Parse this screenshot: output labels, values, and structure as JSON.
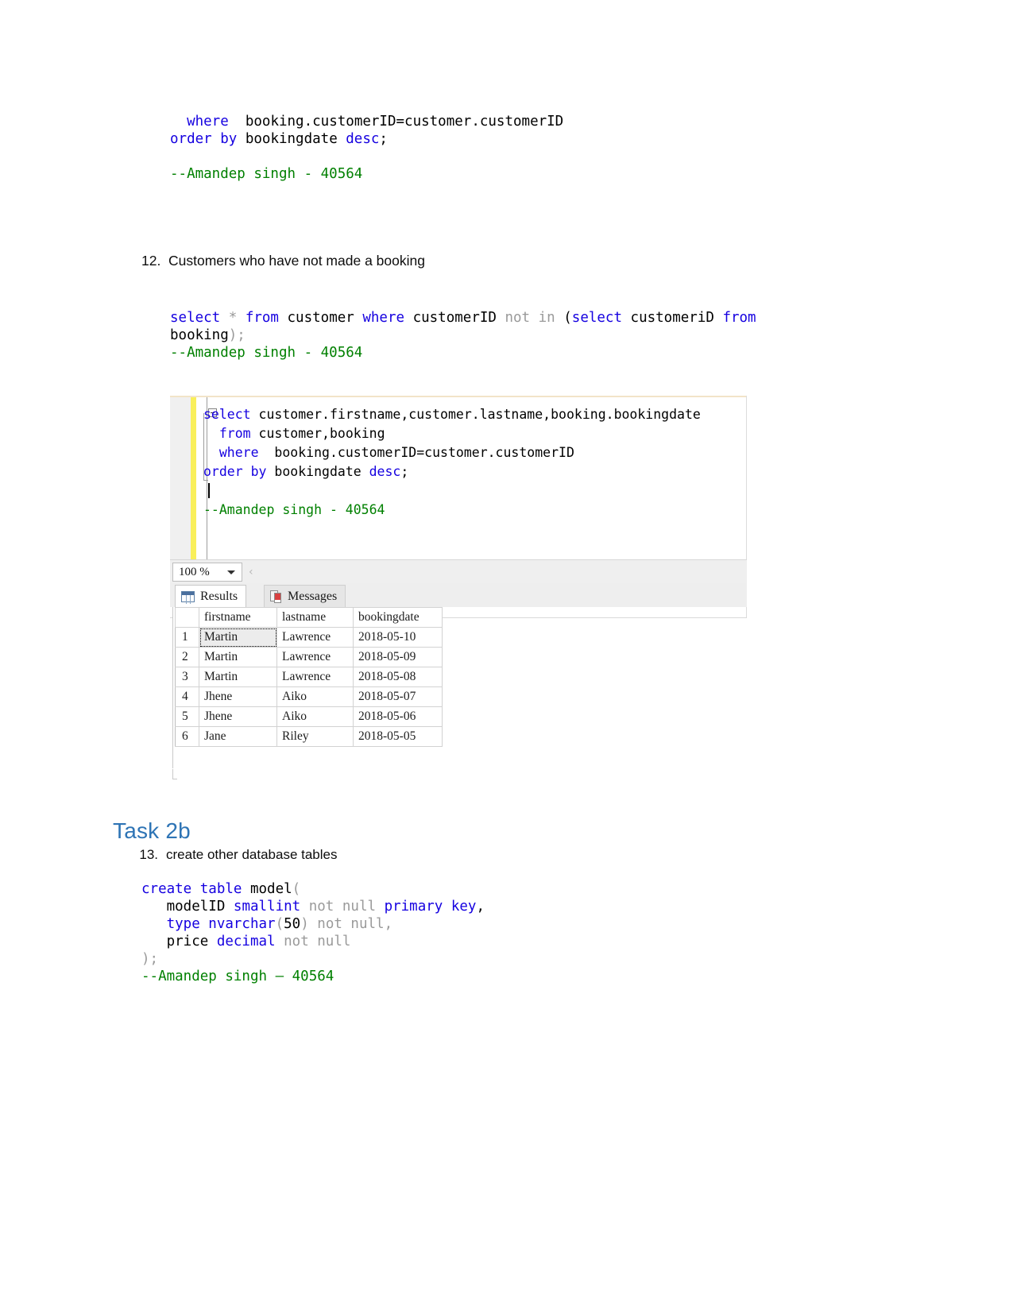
{
  "document": {
    "top_code_fragment": {
      "lines": [
        [
          {
            "t": "  ",
            "c": "blk"
          },
          {
            "t": "where",
            "c": "kw"
          },
          {
            "t": "  booking",
            "c": "blk"
          },
          {
            "t": ".",
            "c": "blk"
          },
          {
            "t": "customerID=customer.customerID",
            "c": "blk"
          }
        ],
        [
          {
            "t": "order by",
            "c": "kw"
          },
          {
            "t": " bookingdate ",
            "c": "blk"
          },
          {
            "t": "desc",
            "c": "kw"
          },
          {
            "t": ";",
            "c": "blk"
          }
        ],
        [
          {
            "t": "",
            "c": "blk"
          }
        ],
        [
          {
            "t": "--Amandep singh - 40564",
            "c": "cmt"
          }
        ]
      ],
      "plain": "  where  booking.customerID=customer.customerID\norder by bookingdate desc;\n\n--Amandep singh - 40564"
    },
    "items": [
      {
        "number": "12.",
        "text": "Customers who have not made a booking",
        "code_lines": [
          [
            {
              "t": "select",
              "c": "kw"
            },
            {
              "t": " * ",
              "c": "gray"
            },
            {
              "t": "from",
              "c": "kw"
            },
            {
              "t": " customer ",
              "c": "blk"
            },
            {
              "t": "where",
              "c": "kw"
            },
            {
              "t": " customerID ",
              "c": "blk"
            },
            {
              "t": "not in ",
              "c": "gray"
            },
            {
              "t": "(",
              "c": "blk"
            },
            {
              "t": "select",
              "c": "kw"
            },
            {
              "t": " customeriD ",
              "c": "blk"
            },
            {
              "t": "from",
              "c": "kw"
            }
          ],
          [
            {
              "t": "booking",
              "c": "blk"
            },
            {
              "t": ");",
              "c": "gray"
            }
          ],
          [
            {
              "t": "--Amandep singh - 40564",
              "c": "cmt"
            }
          ]
        ],
        "code_plain": "select * from customer where customerID not in (select customeriD from booking);\n--Amandep singh - 40564"
      },
      {
        "number": "13.",
        "text": "create other database tables",
        "code_lines": [
          [
            {
              "t": "create table",
              "c": "kw"
            },
            {
              "t": " model",
              "c": "blk"
            },
            {
              "t": "(",
              "c": "gray"
            }
          ],
          [
            {
              "t": "   modelID ",
              "c": "blk"
            },
            {
              "t": "smallint",
              "c": "kw"
            },
            {
              "t": " not null ",
              "c": "gray"
            },
            {
              "t": "primary key",
              "c": "kw"
            },
            {
              "t": ",",
              "c": "blk"
            }
          ],
          [
            {
              "t": "   ",
              "c": "blk"
            },
            {
              "t": "type nvarchar",
              "c": "kw"
            },
            {
              "t": "(",
              "c": "gray"
            },
            {
              "t": "50",
              "c": "blk"
            },
            {
              "t": ")",
              "c": "gray"
            },
            {
              "t": " not null,",
              "c": "gray"
            }
          ],
          [
            {
              "t": "   price ",
              "c": "blk"
            },
            {
              "t": "decimal",
              "c": "kw"
            },
            {
              "t": " not null",
              "c": "gray"
            }
          ],
          [
            {
              "t": ");",
              "c": "gray"
            }
          ],
          [
            {
              "t": "--Amandep singh – 40564",
              "c": "cmt"
            }
          ]
        ],
        "code_plain": "create table model(\n   modelID smallint not null primary key,\n   type nvarchar(50) not null,\n   price decimal not null\n);\n--Amandep singh – 40564"
      }
    ],
    "heading": "Task 2b"
  },
  "ssms": {
    "editor": {
      "lines": [
        [
          {
            "t": "select",
            "c": "kw"
          },
          {
            "t": " customer.firstname,customer.lastname,booking.bookingdate",
            "c": "blk"
          }
        ],
        [
          {
            "t": "  ",
            "c": "blk"
          },
          {
            "t": "from",
            "c": "kw"
          },
          {
            "t": " customer,booking",
            "c": "blk"
          }
        ],
        [
          {
            "t": "  ",
            "c": "blk"
          },
          {
            "t": "where",
            "c": "kw"
          },
          {
            "t": "  booking.customerID=customer.customerID",
            "c": "blk"
          }
        ],
        [
          {
            "t": "order by",
            "c": "kw"
          },
          {
            "t": " bookingdate ",
            "c": "blk"
          },
          {
            "t": "desc",
            "c": "kw"
          },
          {
            "t": ";",
            "c": "blk"
          }
        ],
        [
          {
            "t": "",
            "c": "blk"
          }
        ],
        [
          {
            "t": "--Amandep singh - 40564",
            "c": "cmt"
          }
        ]
      ],
      "plain": "select customer.firstname,customer.lastname,booking.bookingdate\n  from customer,booking\n  where  booking.customerID=customer.customerID\norder by bookingdate desc;\n\n--Amandep singh - 40564"
    },
    "zoom_value": "100 %",
    "tabs": [
      {
        "label": "Results",
        "icon": "results-grid-icon",
        "active": true
      },
      {
        "label": "Messages",
        "icon": "messages-document-icon",
        "active": false
      }
    ],
    "results": {
      "columns": [
        "firstname",
        "lastname",
        "bookingdate"
      ],
      "rows": [
        {
          "n": "1",
          "firstname": "Martin",
          "lastname": "Lawrence",
          "bookingdate": "2018-05-10"
        },
        {
          "n": "2",
          "firstname": "Martin",
          "lastname": "Lawrence",
          "bookingdate": "2018-05-09"
        },
        {
          "n": "3",
          "firstname": "Martin",
          "lastname": "Lawrence",
          "bookingdate": "2018-05-08"
        },
        {
          "n": "4",
          "firstname": "Jhene",
          "lastname": "Aiko",
          "bookingdate": "2018-05-07"
        },
        {
          "n": "5",
          "firstname": "Jhene",
          "lastname": "Aiko",
          "bookingdate": "2018-05-06"
        },
        {
          "n": "6",
          "firstname": "Jane",
          "lastname": "Riley",
          "bookingdate": "2018-05-05"
        }
      ],
      "selected_cell": {
        "row": 0,
        "column": "firstname"
      }
    }
  },
  "colors": {
    "keyword": "#1500e0",
    "comment": "#008000",
    "gray_token": "#9a9a9a",
    "heading": "#2e74b5",
    "change_bar": "#f9ef5a"
  }
}
